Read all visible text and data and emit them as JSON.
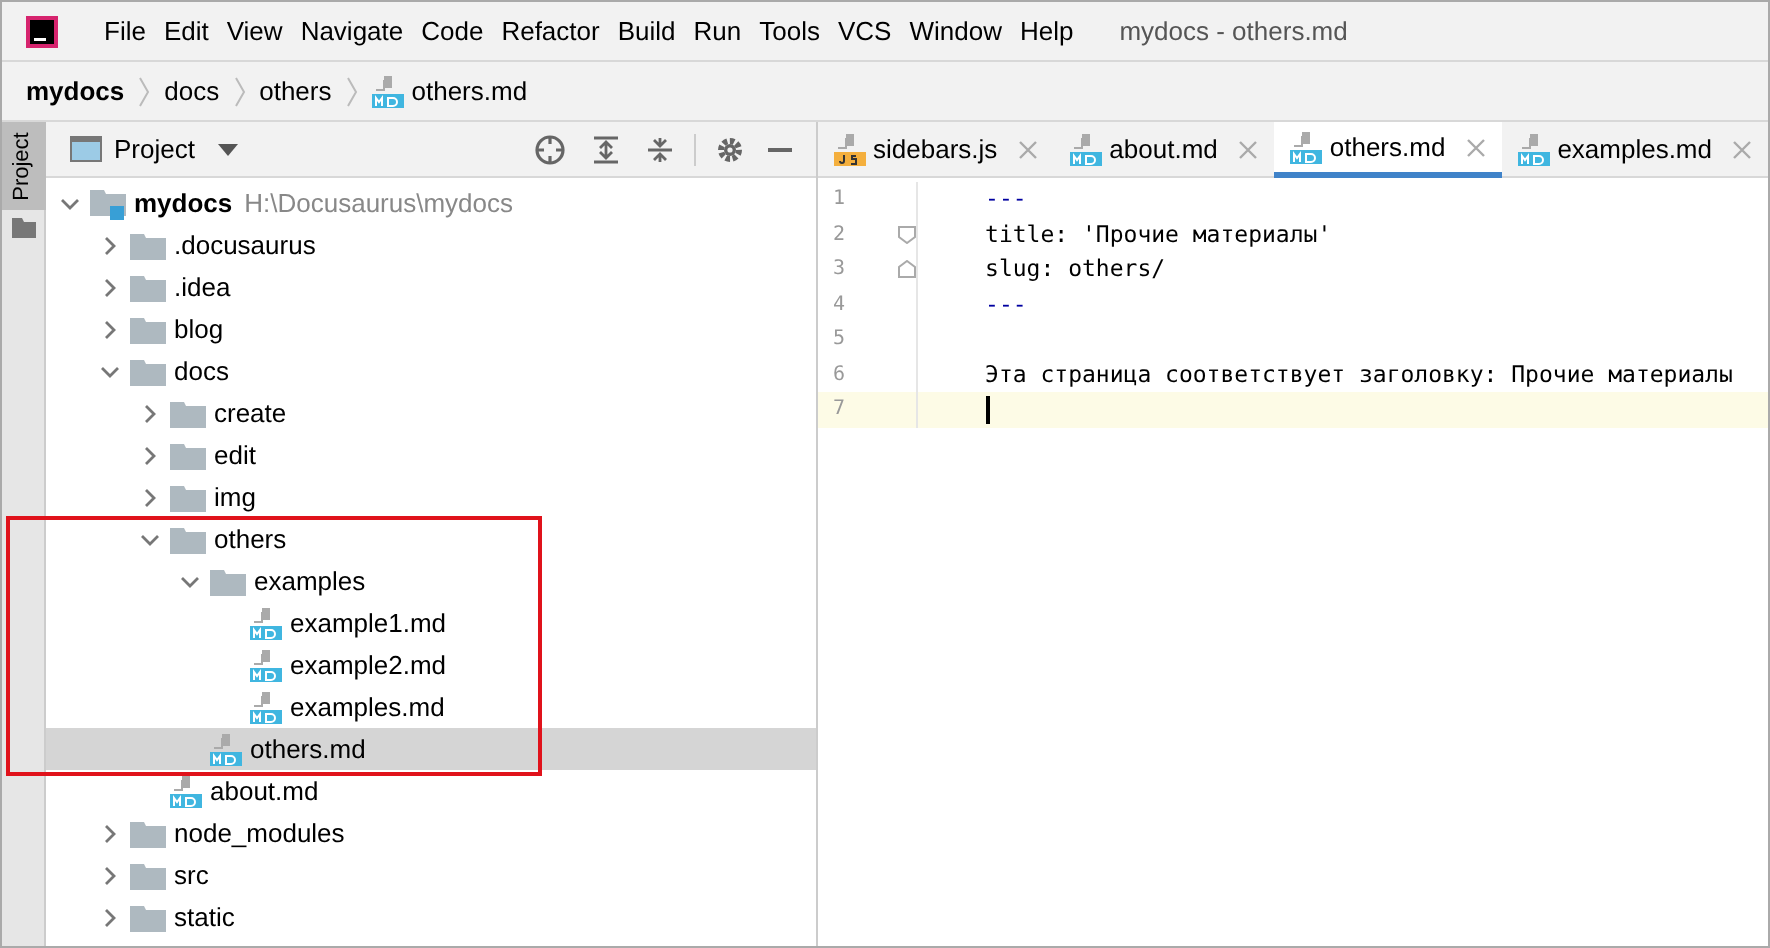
{
  "window": {
    "title": "mydocs - others.md"
  },
  "menu": [
    "File",
    "Edit",
    "View",
    "Navigate",
    "Code",
    "Refactor",
    "Build",
    "Run",
    "Tools",
    "VCS",
    "Window",
    "Help"
  ],
  "breadcrumbs": [
    {
      "label": "mydocs",
      "kind": "project"
    },
    {
      "label": "docs",
      "kind": "folder"
    },
    {
      "label": "others",
      "kind": "folder"
    },
    {
      "label": "others.md",
      "kind": "md"
    }
  ],
  "side_tab": {
    "label": "Project",
    "selected": true
  },
  "project_panel": {
    "title": "Project"
  },
  "tree": [
    {
      "label": "mydocs",
      "path": "H:\\Docusaurus\\mydocs",
      "kind": "module",
      "expanded": true,
      "selected": false,
      "highlighted": false,
      "children": [
        {
          "label": ".docusaurus",
          "kind": "folder",
          "expanded": false,
          "selected": false,
          "highlighted": false
        },
        {
          "label": ".idea",
          "kind": "folder",
          "expanded": false,
          "selected": false,
          "highlighted": false
        },
        {
          "label": "blog",
          "kind": "folder",
          "expanded": false,
          "selected": false,
          "highlighted": false
        },
        {
          "label": "docs",
          "kind": "folder",
          "expanded": true,
          "selected": false,
          "highlighted": false,
          "children": [
            {
              "label": "create",
              "kind": "folder",
              "expanded": false,
              "selected": false,
              "highlighted": false
            },
            {
              "label": "edit",
              "kind": "folder",
              "expanded": false,
              "selected": false,
              "highlighted": false
            },
            {
              "label": "img",
              "kind": "folder",
              "expanded": false,
              "selected": false,
              "highlighted": false
            },
            {
              "label": "others",
              "kind": "folder",
              "expanded": true,
              "selected": false,
              "highlighted": true,
              "children": [
                {
                  "label": "examples",
                  "kind": "folder",
                  "expanded": true,
                  "selected": false,
                  "highlighted": false,
                  "children": [
                    {
                      "label": "example1.md",
                      "kind": "md",
                      "selected": false,
                      "highlighted": false
                    },
                    {
                      "label": "example2.md",
                      "kind": "md",
                      "selected": false,
                      "highlighted": false
                    },
                    {
                      "label": "examples.md",
                      "kind": "md",
                      "selected": false,
                      "highlighted": false
                    }
                  ]
                },
                {
                  "label": "others.md",
                  "kind": "md",
                  "selected": true,
                  "highlighted": false
                }
              ]
            },
            {
              "label": "about.md",
              "kind": "md",
              "selected": false,
              "highlighted": false
            }
          ]
        },
        {
          "label": "node_modules",
          "kind": "folder",
          "expanded": false,
          "selected": false,
          "highlighted": false
        },
        {
          "label": "src",
          "kind": "folder",
          "expanded": false,
          "selected": false,
          "highlighted": false
        },
        {
          "label": "static",
          "kind": "folder",
          "expanded": false,
          "selected": false,
          "highlighted": false
        }
      ]
    }
  ],
  "tabs": [
    {
      "label": "sidebars.js",
      "kind": "js",
      "selected": false
    },
    {
      "label": "about.md",
      "kind": "md",
      "selected": false
    },
    {
      "label": "others.md",
      "kind": "md",
      "selected": true
    },
    {
      "label": "examples.md",
      "kind": "md",
      "selected": false
    }
  ],
  "editor": {
    "lines": [
      {
        "number": "1",
        "text": "---",
        "kind": "delimiter",
        "fold_start": false,
        "fold_end": false,
        "current": false
      },
      {
        "number": "2",
        "text": "title: 'Прочие материалы'",
        "kind": "text",
        "fold_start": true,
        "fold_end": false,
        "current": false
      },
      {
        "number": "3",
        "text": "slug: others/",
        "kind": "text",
        "fold_start": false,
        "fold_end": true,
        "current": false
      },
      {
        "number": "4",
        "text": "---",
        "kind": "delimiter",
        "fold_start": false,
        "fold_end": false,
        "current": false
      },
      {
        "number": "5",
        "fold_start": false,
        "fold_end": false,
        "current": false
      },
      {
        "number": "6",
        "text": "Эта страница соответствует заголовку: Прочие материалы",
        "kind": "text",
        "fold_start": false,
        "fold_end": false,
        "current": false
      },
      {
        "number": "7",
        "fold_start": false,
        "fold_end": false,
        "current": true
      }
    ]
  }
}
